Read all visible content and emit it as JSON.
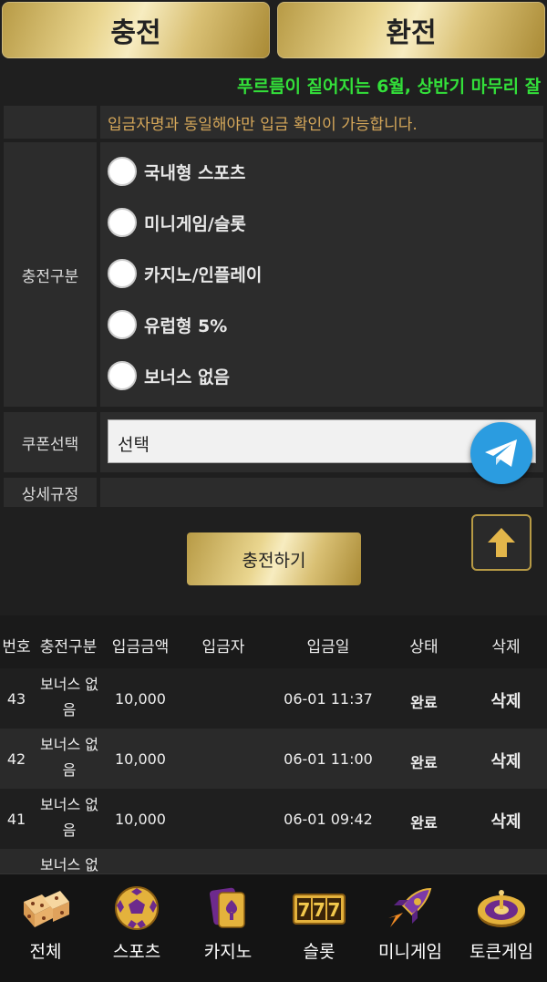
{
  "tabs": {
    "charge": "충전",
    "exchange": "환전"
  },
  "marquee": "푸르름이 짙어지는 6월, 상반기 마무리 잘",
  "form": {
    "notice": "입금자명과 동일해야만 입금 확인이 가능합니다.",
    "category_label": "충전구분",
    "options": [
      "국내형 스포츠",
      "미니게임/슬롯",
      "카지노/인플레이",
      "유럽형 5%",
      "보너스 없음"
    ],
    "coupon_label": "쿠폰선택",
    "coupon_value": "선택",
    "rules_label": "상세규정",
    "submit": "충전하기"
  },
  "table": {
    "headers": [
      "번호",
      "충전구분",
      "입금금액",
      "입금자",
      "입금일",
      "상태",
      "삭제"
    ],
    "rows": [
      {
        "no": "43",
        "cat1": "보너스 없",
        "cat2": "음",
        "amount": "10,000",
        "depositor": "",
        "date": "06-01 11:37",
        "status": "완료",
        "delete": "삭제"
      },
      {
        "no": "42",
        "cat1": "보너스 없",
        "cat2": "음",
        "amount": "10,000",
        "depositor": "",
        "date": "06-01 11:00",
        "status": "완료",
        "delete": "삭제"
      },
      {
        "no": "41",
        "cat1": "보너스 없",
        "cat2": "음",
        "amount": "10,000",
        "depositor": "",
        "date": "06-01 09:42",
        "status": "완료",
        "delete": "삭제"
      },
      {
        "no": "",
        "cat1": "보너스 없",
        "cat2": "",
        "amount": "",
        "depositor": "",
        "date": "",
        "status": "",
        "delete": ""
      }
    ]
  },
  "nav": [
    {
      "label": "전체",
      "icon": "dice-icon"
    },
    {
      "label": "스포츠",
      "icon": "soccer-ball-icon"
    },
    {
      "label": "카지노",
      "icon": "cards-icon"
    },
    {
      "label": "슬롯",
      "icon": "slot-777-icon"
    },
    {
      "label": "미니게임",
      "icon": "rocket-icon"
    },
    {
      "label": "토큰게임",
      "icon": "roulette-icon"
    }
  ],
  "colors": {
    "gold": "#d9c074",
    "marquee_green": "#33e03a",
    "notice_orange": "#d6a85a",
    "telegram_blue": "#2b9ce0"
  }
}
